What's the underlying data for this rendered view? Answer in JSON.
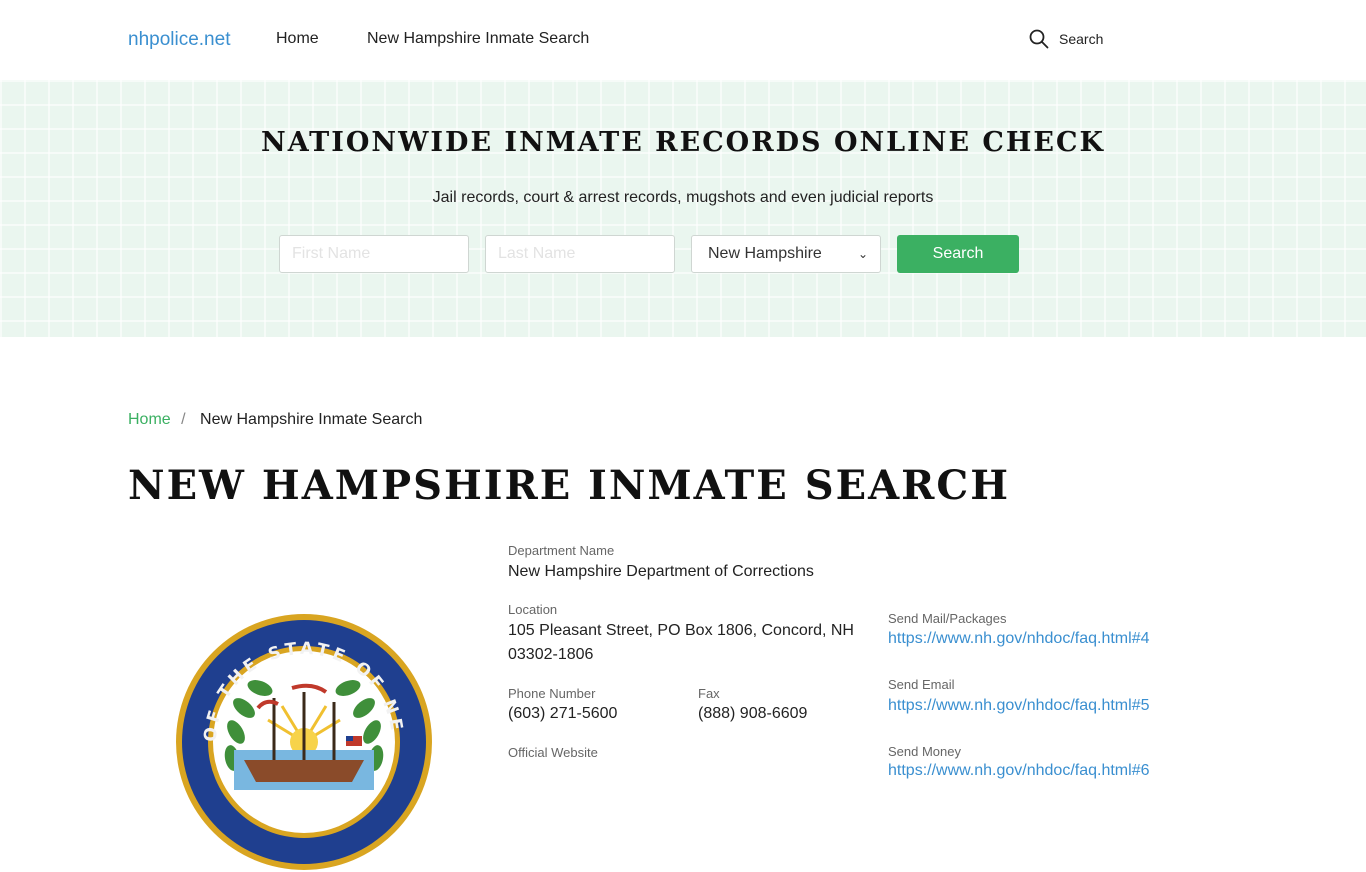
{
  "nav": {
    "brand": "nhpolice.net",
    "home": "Home",
    "inmate_search": "New Hampshire Inmate Search",
    "search_label": "Search"
  },
  "hero": {
    "title": "NATIONWIDE INMATE RECORDS ONLINE CHECK",
    "subtitle": "Jail records, court & arrest records, mugshots and even judicial reports",
    "first_name_placeholder": "First Name",
    "last_name_placeholder": "Last Name",
    "state_selected": "New Hampshire",
    "search_button": "Search"
  },
  "breadcrumb": {
    "home": "Home",
    "separator": "/",
    "current": "New Hampshire Inmate Search"
  },
  "page_title": "NEW HAMPSHIRE INMATE SEARCH",
  "seal": {
    "ring_text": "OF THE STATE OF NEW HAMPSHIRE",
    "colors": {
      "ring": "#1f3f8f",
      "gold": "#d9a521",
      "leaves": "#3f8f3a"
    }
  },
  "info": {
    "department_label": "Department Name",
    "department_value": "New Hampshire Department of Corrections",
    "location_label": "Location",
    "location_line1": "105 Pleasant Street, PO Box 1806, Concord, NH",
    "location_line2": "03302-1806",
    "phone_label": "Phone Number",
    "phone_value": "(603) 271-5600",
    "fax_label": "Fax",
    "fax_value": "(888) 908-6609",
    "website_label": "Official Website",
    "mail_label": "Send Mail/Packages",
    "mail_link": "https://www.nh.gov/nhdoc/faq.html#4",
    "email_label": "Send Email",
    "email_link": "https://www.nh.gov/nhdoc/faq.html#5",
    "money_label": "Send Money",
    "money_link": "https://www.nh.gov/nhdoc/faq.html#6"
  },
  "colors": {
    "accent_green": "#3bb062",
    "link_blue": "#3a8fd0",
    "hero_bg": "#eaf6ef"
  }
}
